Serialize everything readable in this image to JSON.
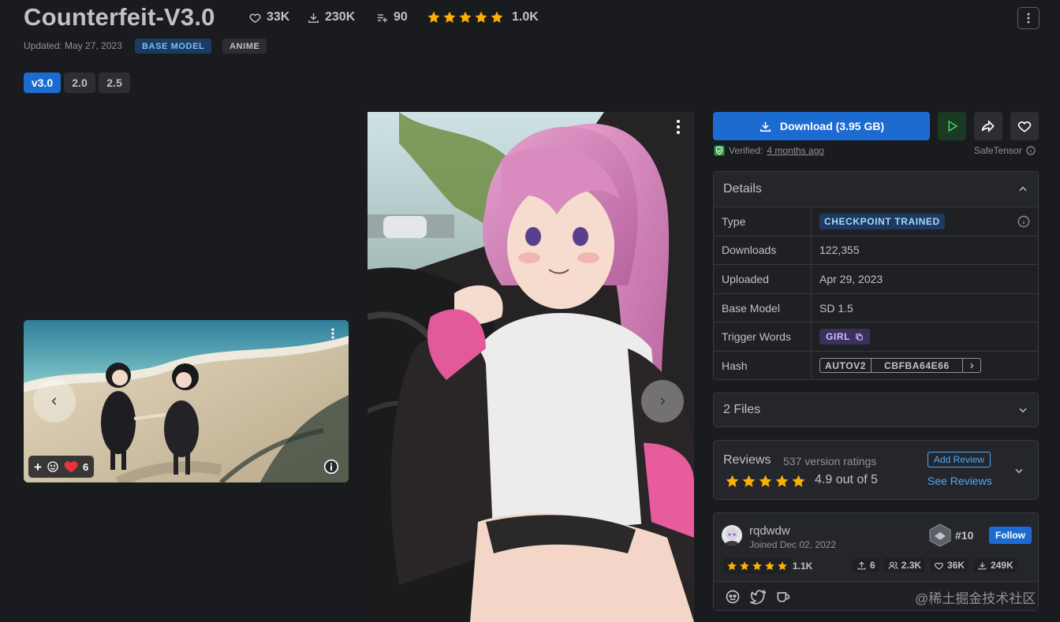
{
  "model": {
    "title": "Counterfeit-V3.0",
    "likes": "33K",
    "downloads": "230K",
    "collections": "90",
    "rating_count": "1.0K",
    "updated": "Updated: May 27, 2023",
    "badges": [
      "BASE MODEL",
      "ANIME"
    ]
  },
  "versions": [
    "v3.0",
    "2.0",
    "2.5"
  ],
  "gallery": {
    "reaction_count": "6"
  },
  "download": {
    "label": "Download (3.95 GB)",
    "verified_prefix": "Verified:",
    "verified_time": "4 months ago",
    "format": "SafeTensor"
  },
  "details": {
    "title": "Details",
    "rows": {
      "type_label": "Type",
      "type_value": "CHECKPOINT TRAINED",
      "downloads_label": "Downloads",
      "downloads_value": "122,355",
      "uploaded_label": "Uploaded",
      "uploaded_value": "Apr 29, 2023",
      "base_label": "Base Model",
      "base_value": "SD 1.5",
      "trigger_label": "Trigger Words",
      "trigger_value": "GIRL",
      "hash_label": "Hash",
      "hash_type": "AUTOV2",
      "hash_value": "CBFBA64E66"
    }
  },
  "files": {
    "label": "2 Files"
  },
  "reviews": {
    "title": "Reviews",
    "count": "537 version ratings",
    "score": "4.9 out of 5",
    "add_label": "Add Review",
    "see_label": "See Reviews",
    "rating": 4.9
  },
  "creator": {
    "name": "rqdwdw",
    "joined": "Joined Dec 02, 2022",
    "rank": "#10",
    "follow_label": "Follow",
    "rating_count": "1.1K",
    "uploads": "6",
    "followers": "2.3K",
    "likes": "36K",
    "downloads": "249K"
  },
  "watermark": "@稀土掘金技术社区",
  "colors": {
    "accent": "#1c6bd1",
    "star": "#fab005",
    "background": "#1a1b1e"
  }
}
